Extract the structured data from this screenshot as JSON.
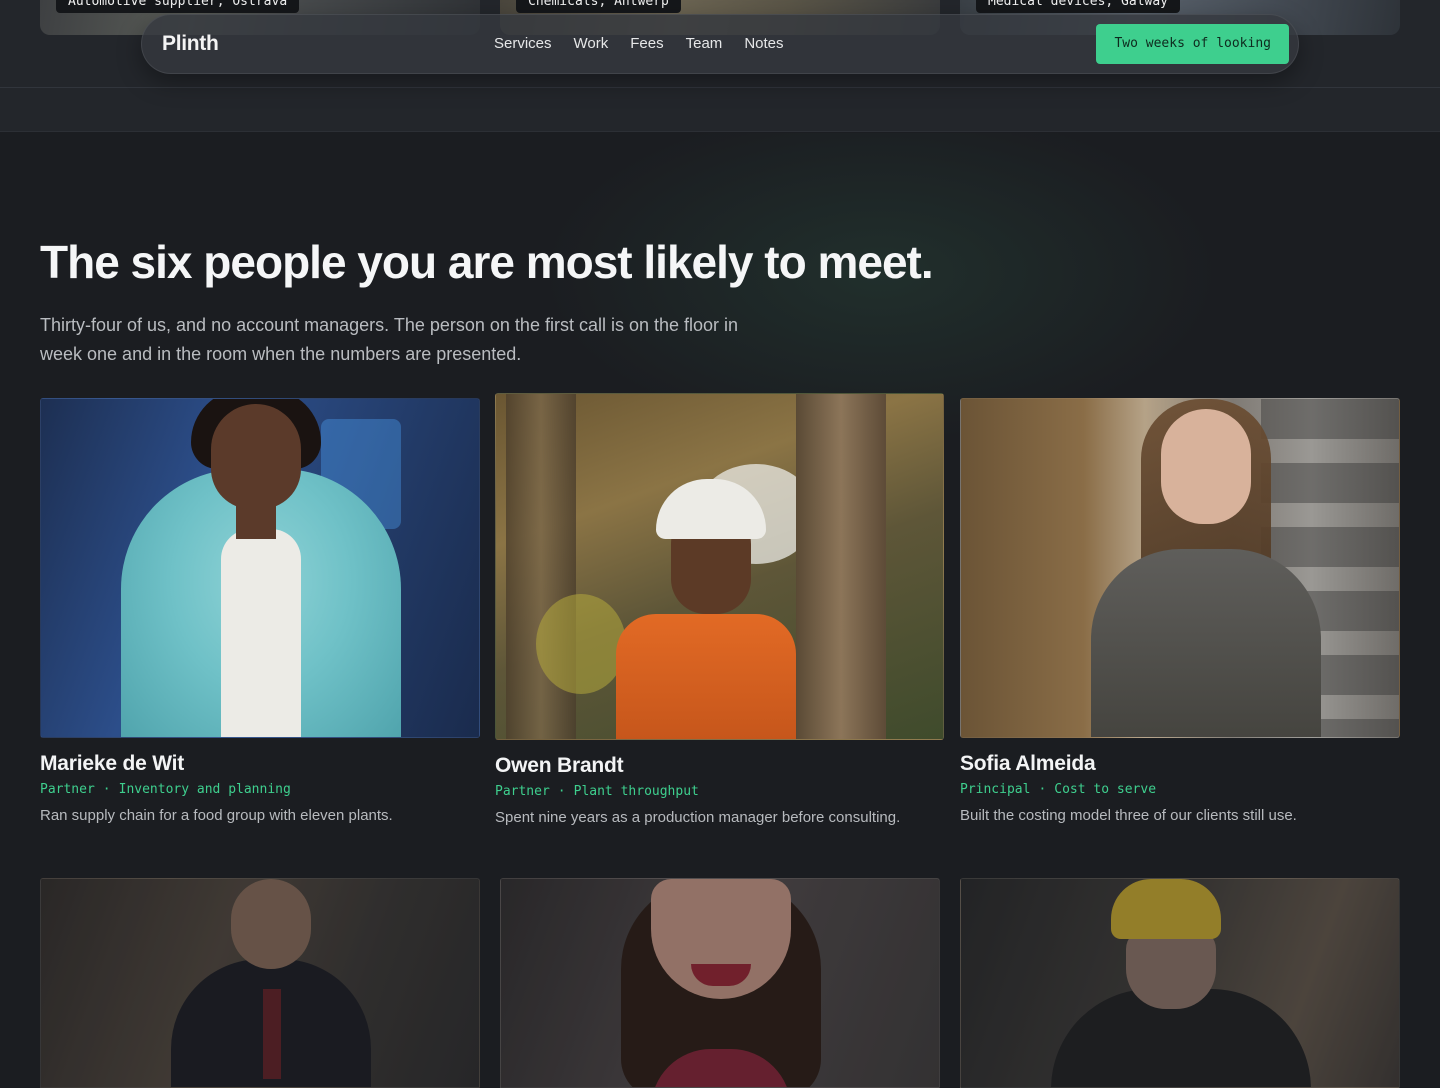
{
  "cases": [
    {
      "tag": "Automotive supplier, Ostrava"
    },
    {
      "tag": "Chemicals, Antwerp"
    },
    {
      "tag": "Medical devices, Galway"
    }
  ],
  "nav": {
    "brand": "Plinth",
    "links": [
      "Services",
      "Work",
      "Fees",
      "Team",
      "Notes"
    ],
    "cta": "Two weeks of looking"
  },
  "team": {
    "title": "The six people you are most likely to meet.",
    "intro": "Thirty-four of us, and no account managers. The person on the first call is on the floor in week one and in the room when the numbers are presented.",
    "people": [
      {
        "name": "Marieke de Wit",
        "title": "Partner",
        "area": "Inventory and planning",
        "bio": "Ran supply chain for a food group with eleven plants."
      },
      {
        "name": "Owen Brandt",
        "title": "Partner",
        "area": "Plant throughput",
        "bio": "Spent nine years as a production manager before consulting."
      },
      {
        "name": "Sofia Almeida",
        "title": "Principal",
        "area": "Cost to serve",
        "bio": "Built the costing model three of our clients still use."
      }
    ],
    "role_separator": "·"
  },
  "colors": {
    "background": "#1b1d21",
    "accent": "#3ecf8e",
    "text": "#f2f3f4",
    "muted": "#b9bcc0"
  }
}
